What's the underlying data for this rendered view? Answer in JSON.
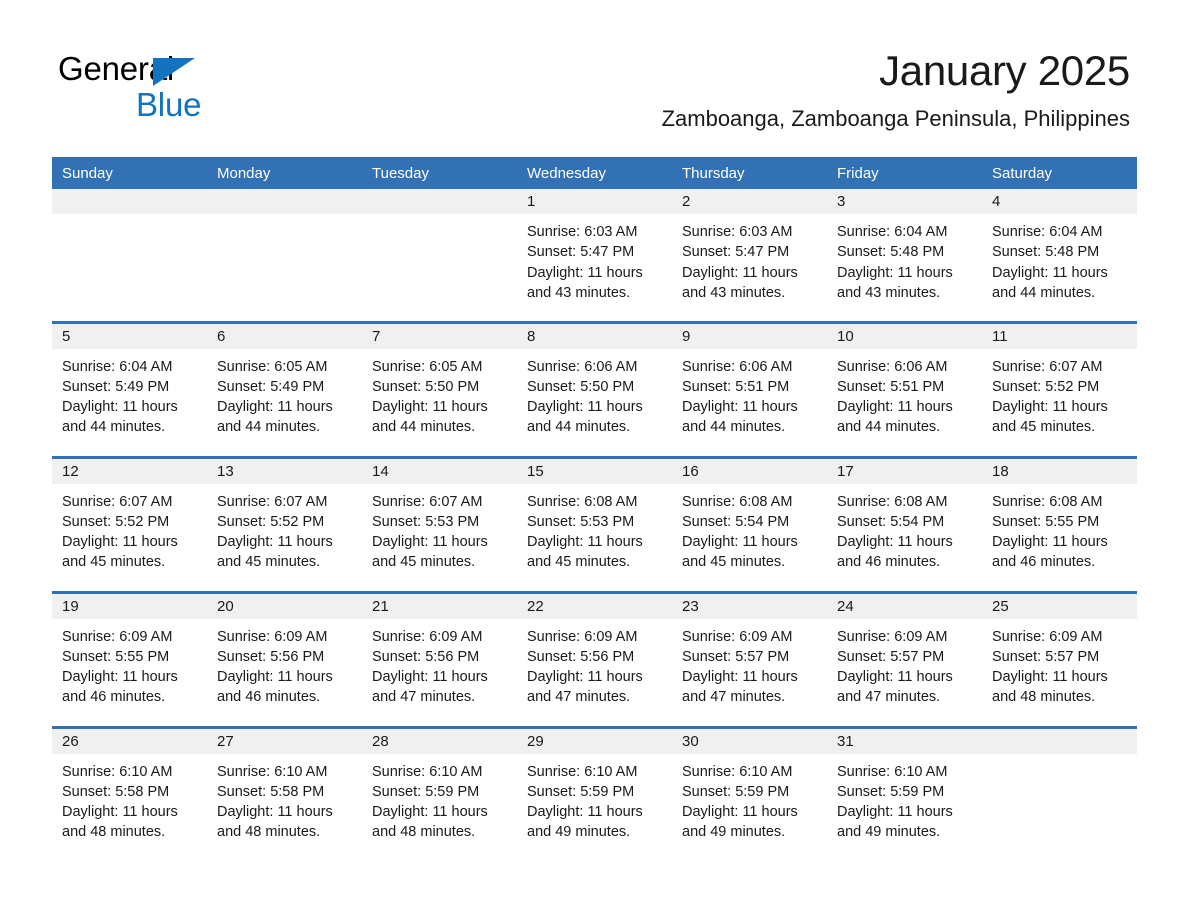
{
  "brand": {
    "name_part1": "General",
    "name_part2": "Blue",
    "accent_color": "#1273c1",
    "triangle_icon": "triangle-logo-icon"
  },
  "header": {
    "title": "January 2025",
    "location": "Zamboanga, Zamboanga Peninsula, Philippines"
  },
  "calendar": {
    "header_bg": "#3171b4",
    "daynum_band_bg": "#f0f0f0",
    "weekdays": [
      "Sunday",
      "Monday",
      "Tuesday",
      "Wednesday",
      "Thursday",
      "Friday",
      "Saturday"
    ],
    "weeks": [
      [
        {
          "day": ""
        },
        {
          "day": ""
        },
        {
          "day": ""
        },
        {
          "day": "1",
          "sunrise": "Sunrise: 6:03 AM",
          "sunset": "Sunset: 5:47 PM",
          "daylight": "Daylight: 11 hours and 43 minutes."
        },
        {
          "day": "2",
          "sunrise": "Sunrise: 6:03 AM",
          "sunset": "Sunset: 5:47 PM",
          "daylight": "Daylight: 11 hours and 43 minutes."
        },
        {
          "day": "3",
          "sunrise": "Sunrise: 6:04 AM",
          "sunset": "Sunset: 5:48 PM",
          "daylight": "Daylight: 11 hours and 43 minutes."
        },
        {
          "day": "4",
          "sunrise": "Sunrise: 6:04 AM",
          "sunset": "Sunset: 5:48 PM",
          "daylight": "Daylight: 11 hours and 44 minutes."
        }
      ],
      [
        {
          "day": "5",
          "sunrise": "Sunrise: 6:04 AM",
          "sunset": "Sunset: 5:49 PM",
          "daylight": "Daylight: 11 hours and 44 minutes."
        },
        {
          "day": "6",
          "sunrise": "Sunrise: 6:05 AM",
          "sunset": "Sunset: 5:49 PM",
          "daylight": "Daylight: 11 hours and 44 minutes."
        },
        {
          "day": "7",
          "sunrise": "Sunrise: 6:05 AM",
          "sunset": "Sunset: 5:50 PM",
          "daylight": "Daylight: 11 hours and 44 minutes."
        },
        {
          "day": "8",
          "sunrise": "Sunrise: 6:06 AM",
          "sunset": "Sunset: 5:50 PM",
          "daylight": "Daylight: 11 hours and 44 minutes."
        },
        {
          "day": "9",
          "sunrise": "Sunrise: 6:06 AM",
          "sunset": "Sunset: 5:51 PM",
          "daylight": "Daylight: 11 hours and 44 minutes."
        },
        {
          "day": "10",
          "sunrise": "Sunrise: 6:06 AM",
          "sunset": "Sunset: 5:51 PM",
          "daylight": "Daylight: 11 hours and 44 minutes."
        },
        {
          "day": "11",
          "sunrise": "Sunrise: 6:07 AM",
          "sunset": "Sunset: 5:52 PM",
          "daylight": "Daylight: 11 hours and 45 minutes."
        }
      ],
      [
        {
          "day": "12",
          "sunrise": "Sunrise: 6:07 AM",
          "sunset": "Sunset: 5:52 PM",
          "daylight": "Daylight: 11 hours and 45 minutes."
        },
        {
          "day": "13",
          "sunrise": "Sunrise: 6:07 AM",
          "sunset": "Sunset: 5:52 PM",
          "daylight": "Daylight: 11 hours and 45 minutes."
        },
        {
          "day": "14",
          "sunrise": "Sunrise: 6:07 AM",
          "sunset": "Sunset: 5:53 PM",
          "daylight": "Daylight: 11 hours and 45 minutes."
        },
        {
          "day": "15",
          "sunrise": "Sunrise: 6:08 AM",
          "sunset": "Sunset: 5:53 PM",
          "daylight": "Daylight: 11 hours and 45 minutes."
        },
        {
          "day": "16",
          "sunrise": "Sunrise: 6:08 AM",
          "sunset": "Sunset: 5:54 PM",
          "daylight": "Daylight: 11 hours and 45 minutes."
        },
        {
          "day": "17",
          "sunrise": "Sunrise: 6:08 AM",
          "sunset": "Sunset: 5:54 PM",
          "daylight": "Daylight: 11 hours and 46 minutes."
        },
        {
          "day": "18",
          "sunrise": "Sunrise: 6:08 AM",
          "sunset": "Sunset: 5:55 PM",
          "daylight": "Daylight: 11 hours and 46 minutes."
        }
      ],
      [
        {
          "day": "19",
          "sunrise": "Sunrise: 6:09 AM",
          "sunset": "Sunset: 5:55 PM",
          "daylight": "Daylight: 11 hours and 46 minutes."
        },
        {
          "day": "20",
          "sunrise": "Sunrise: 6:09 AM",
          "sunset": "Sunset: 5:56 PM",
          "daylight": "Daylight: 11 hours and 46 minutes."
        },
        {
          "day": "21",
          "sunrise": "Sunrise: 6:09 AM",
          "sunset": "Sunset: 5:56 PM",
          "daylight": "Daylight: 11 hours and 47 minutes."
        },
        {
          "day": "22",
          "sunrise": "Sunrise: 6:09 AM",
          "sunset": "Sunset: 5:56 PM",
          "daylight": "Daylight: 11 hours and 47 minutes."
        },
        {
          "day": "23",
          "sunrise": "Sunrise: 6:09 AM",
          "sunset": "Sunset: 5:57 PM",
          "daylight": "Daylight: 11 hours and 47 minutes."
        },
        {
          "day": "24",
          "sunrise": "Sunrise: 6:09 AM",
          "sunset": "Sunset: 5:57 PM",
          "daylight": "Daylight: 11 hours and 47 minutes."
        },
        {
          "day": "25",
          "sunrise": "Sunrise: 6:09 AM",
          "sunset": "Sunset: 5:57 PM",
          "daylight": "Daylight: 11 hours and 48 minutes."
        }
      ],
      [
        {
          "day": "26",
          "sunrise": "Sunrise: 6:10 AM",
          "sunset": "Sunset: 5:58 PM",
          "daylight": "Daylight: 11 hours and 48 minutes."
        },
        {
          "day": "27",
          "sunrise": "Sunrise: 6:10 AM",
          "sunset": "Sunset: 5:58 PM",
          "daylight": "Daylight: 11 hours and 48 minutes."
        },
        {
          "day": "28",
          "sunrise": "Sunrise: 6:10 AM",
          "sunset": "Sunset: 5:59 PM",
          "daylight": "Daylight: 11 hours and 48 minutes."
        },
        {
          "day": "29",
          "sunrise": "Sunrise: 6:10 AM",
          "sunset": "Sunset: 5:59 PM",
          "daylight": "Daylight: 11 hours and 49 minutes."
        },
        {
          "day": "30",
          "sunrise": "Sunrise: 6:10 AM",
          "sunset": "Sunset: 5:59 PM",
          "daylight": "Daylight: 11 hours and 49 minutes."
        },
        {
          "day": "31",
          "sunrise": "Sunrise: 6:10 AM",
          "sunset": "Sunset: 5:59 PM",
          "daylight": "Daylight: 11 hours and 49 minutes."
        },
        {
          "day": ""
        }
      ]
    ]
  }
}
